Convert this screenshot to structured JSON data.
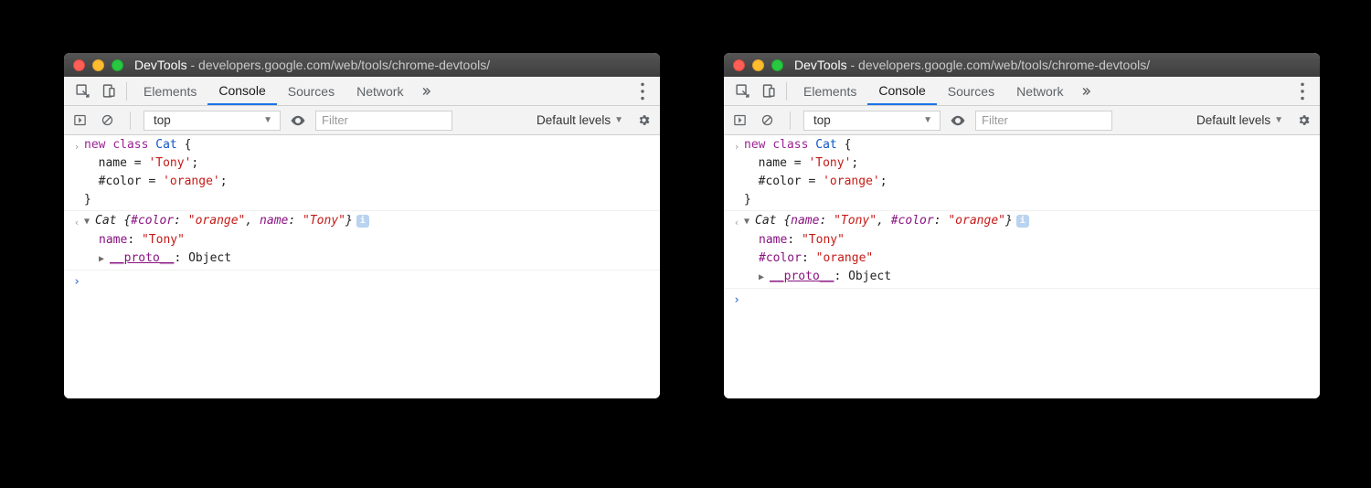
{
  "title_app": "DevTools",
  "title_url": "developers.google.com/web/tools/chrome-devtools/",
  "tabs": [
    "Elements",
    "Console",
    "Sources",
    "Network"
  ],
  "active_tab": "Console",
  "context": "top",
  "filter_placeholder": "Filter",
  "levels_label": "Default levels",
  "input_code": {
    "l1": {
      "kw_new": "new",
      "kw_class": "class",
      "cls": "Cat",
      "open": " {"
    },
    "l2": {
      "indent": "  ",
      "key": "name",
      "eq": " = ",
      "val": "'Tony'",
      "semi": ";"
    },
    "l3": {
      "indent": "  ",
      "key": "#color",
      "eq": " = ",
      "val": "'orange'",
      "semi": ";"
    },
    "l4": "}"
  },
  "left_output": {
    "summary": {
      "cls": "Cat ",
      "open": "{",
      "k1": "#color",
      "v1": "\"orange\"",
      "sep": ", ",
      "k2": "name",
      "v2": "\"Tony\"",
      "close": "}"
    },
    "line_name": {
      "key": "name",
      "colon": ": ",
      "val": "\"Tony\""
    },
    "line_proto": {
      "key": "__proto__",
      "colon": ": ",
      "val": "Object"
    }
  },
  "right_output": {
    "summary": {
      "cls": "Cat ",
      "open": "{",
      "k1": "name",
      "v1": "\"Tony\"",
      "sep": ", ",
      "k2": "#color",
      "v2": "\"orange\"",
      "close": "}"
    },
    "line_name": {
      "key": "name",
      "colon": ": ",
      "val": "\"Tony\""
    },
    "line_color": {
      "key": "#color",
      "colon": ": ",
      "val": "\"orange\""
    },
    "line_proto": {
      "key": "__proto__",
      "colon": ": ",
      "val": "Object"
    }
  }
}
